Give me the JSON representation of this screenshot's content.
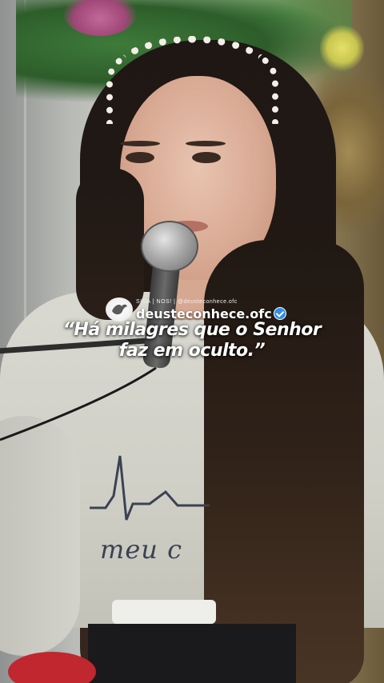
{
  "overlay": {
    "follow_line": "SIGA  |  NOS!  |  @deusteconhece.ofc",
    "brand_name": "deusteconhece.ofc",
    "quote_line1": "“Há milagres que o Senhor",
    "quote_line2": "faz em oculto.”"
  },
  "shirt_print": {
    "text": "meu c"
  },
  "icons": {
    "logo": "dove-logo-icon",
    "verified": "verified-badge-icon"
  },
  "colors": {
    "verified": "#2f8ee8",
    "text": "#ffffff"
  }
}
